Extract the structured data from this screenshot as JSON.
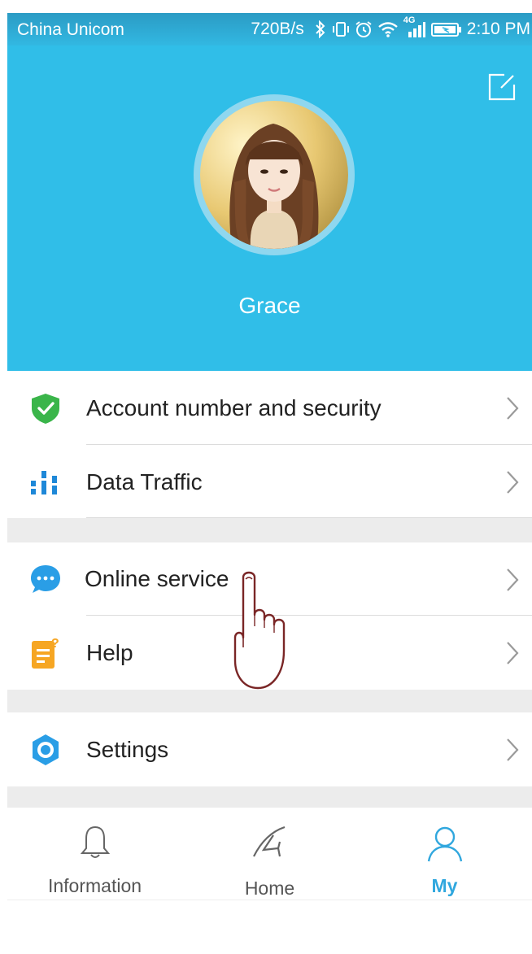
{
  "status_bar": {
    "carrier": "China Unicom",
    "speed": "720B/s",
    "network": "4G",
    "time": "2:10 PM"
  },
  "profile": {
    "name": "Grace"
  },
  "menu": {
    "group1": [
      {
        "label": "Account number and security",
        "icon": "shield-check-icon"
      },
      {
        "label": "Data Traffic",
        "icon": "bar-chart-icon"
      }
    ],
    "group2": [
      {
        "label": "Online service",
        "icon": "chat-bubble-icon"
      },
      {
        "label": "Help",
        "icon": "help-document-icon"
      }
    ],
    "group3": [
      {
        "label": "Settings",
        "icon": "gear-icon"
      }
    ]
  },
  "tabbar": {
    "tabs": [
      {
        "label": "Information",
        "icon": "bell-icon"
      },
      {
        "label": "Home",
        "icon": "home-logo-icon"
      },
      {
        "label": "My",
        "icon": "person-icon",
        "active": true
      }
    ]
  },
  "colors": {
    "header": "#30bee8",
    "active_tab": "#30a7de",
    "shield": "#3ab54a",
    "data_traffic": "#1e88d8",
    "chat": "#2a9ee6",
    "help": "#f6a623",
    "settings": "#2a9ee6"
  }
}
